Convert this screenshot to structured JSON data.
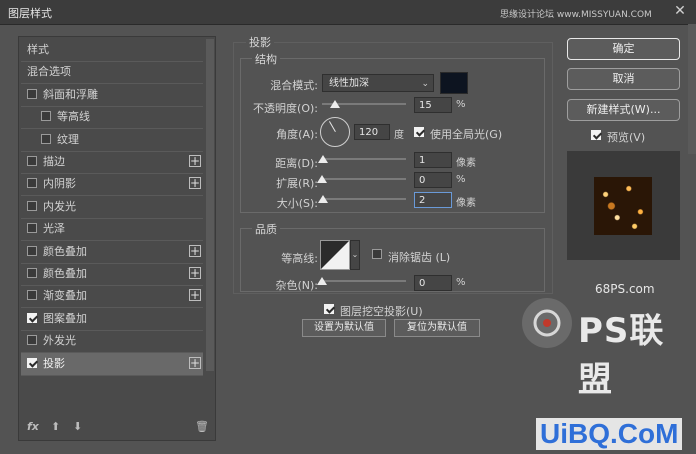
{
  "window": {
    "title": "图层样式",
    "watermark": "思缘设计论坛 www.MISSYUAN.COM",
    "close": "✕"
  },
  "left": {
    "items": [
      {
        "label": "样式",
        "check": null,
        "plus": false,
        "indent": 0,
        "selected": false
      },
      {
        "label": "混合选项",
        "check": null,
        "plus": false,
        "indent": 0,
        "selected": false
      },
      {
        "label": "斜面和浮雕",
        "check": false,
        "plus": false,
        "indent": 0,
        "selected": false
      },
      {
        "label": "等高线",
        "check": false,
        "plus": false,
        "indent": 1,
        "selected": false
      },
      {
        "label": "纹理",
        "check": false,
        "plus": false,
        "indent": 1,
        "selected": false
      },
      {
        "label": "描边",
        "check": false,
        "plus": true,
        "indent": 0,
        "selected": false
      },
      {
        "label": "内阴影",
        "check": false,
        "plus": true,
        "indent": 0,
        "selected": false
      },
      {
        "label": "内发光",
        "check": false,
        "plus": false,
        "indent": 0,
        "selected": false
      },
      {
        "label": "光泽",
        "check": false,
        "plus": false,
        "indent": 0,
        "selected": false
      },
      {
        "label": "颜色叠加",
        "check": false,
        "plus": true,
        "indent": 0,
        "selected": false
      },
      {
        "label": "颜色叠加",
        "check": false,
        "plus": true,
        "indent": 0,
        "selected": false
      },
      {
        "label": "渐变叠加",
        "check": false,
        "plus": true,
        "indent": 0,
        "selected": false
      },
      {
        "label": "图案叠加",
        "check": true,
        "plus": false,
        "indent": 0,
        "selected": false
      },
      {
        "label": "外发光",
        "check": false,
        "plus": false,
        "indent": 0,
        "selected": false
      },
      {
        "label": "投影",
        "check": true,
        "plus": true,
        "indent": 0,
        "selected": true
      }
    ],
    "bottom": {
      "fx": "fx",
      "up": "⬆",
      "down": "⬇",
      "trash": "🗑"
    }
  },
  "shadow": {
    "section_title": "投影",
    "structure_title": "结构",
    "blend_mode_label": "混合模式:",
    "blend_mode_value": "线性加深",
    "shadow_color": "#0d1420",
    "opacity_label": "不透明度(O):",
    "opacity_value": "15",
    "opacity_fraction": 0.15,
    "percent": "%",
    "angle_label": "角度(A):",
    "angle_value": "120",
    "angle_unit": "度",
    "global_light_label": "使用全局光(G)",
    "global_light_checked": true,
    "distance_label": "距离(D):",
    "distance_value": "1",
    "spread_label": "扩展(R):",
    "spread_value": "0",
    "size_label": "大小(S):",
    "size_value": "2",
    "pixels": "像素",
    "quality_title": "品质",
    "contour_label": "等高线:",
    "antialias_label": "消除锯齿 (L)",
    "antialias_checked": false,
    "noise_label": "杂色(N):",
    "noise_value": "0",
    "knockout_label": "图层挖空投影(U)",
    "knockout_checked": true,
    "make_default": "设置为默认值",
    "reset_default": "复位为默认值"
  },
  "right": {
    "ok": "确定",
    "cancel": "取消",
    "new_style": "新建样式(W)...",
    "preview_label": "预览(V)",
    "preview_checked": true
  },
  "watermarks": {
    "site": "68PS.com",
    "brand": "PS联盟",
    "bottom": "UiBQ.CoM"
  }
}
